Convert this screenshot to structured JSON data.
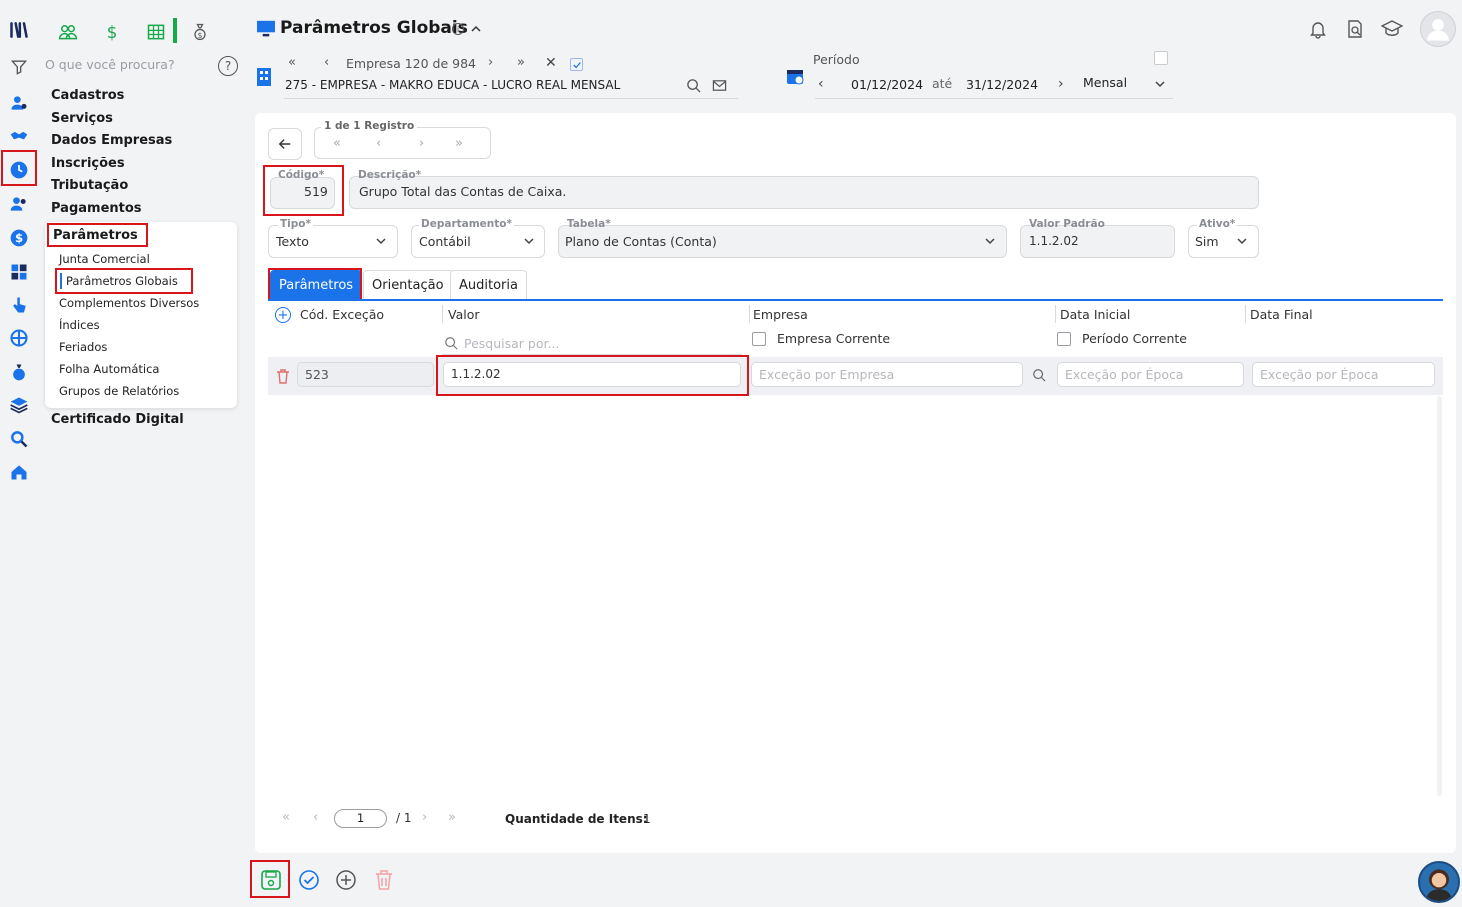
{
  "header": {
    "title": "Parâmetros Globais",
    "empresa_nav": "Empresa 120 de 984",
    "empresa_name": "275 - EMPRESA - MAKRO EDUCA - LUCRO REAL MENSAL",
    "periodo_label": "Período",
    "date_from": "01/12/2024",
    "ate": "até",
    "date_to": "31/12/2024",
    "period_mode": "Mensal"
  },
  "search": {
    "placeholder": "O que você procura?"
  },
  "menu": {
    "items": [
      "Cadastros",
      "Serviços",
      "Dados Empresas",
      "Inscrições",
      "Tributação",
      "Pagamentos",
      "Parâmetros"
    ],
    "sub_items": [
      "Junta Comercial",
      "Parâmetros Globais",
      "Complementos Diversos",
      "Índices",
      "Feriados",
      "Folha Automática",
      "Grupos de Relatórios"
    ],
    "footer_item": "Certificado Digital"
  },
  "record_nav": {
    "label": "1 de 1 Registro"
  },
  "form": {
    "codigo_label": "Código*",
    "codigo_value": "519",
    "descricao_label": "Descrição*",
    "descricao_value": "Grupo Total das Contas de Caixa.",
    "tipo_label": "Tipo*",
    "tipo_value": "Texto",
    "departamento_label": "Departamento*",
    "departamento_value": "Contábil",
    "tabela_label": "Tabela*",
    "tabela_value": "Plano de Contas (Conta)",
    "valor_padrao_label": "Valor Padrão",
    "valor_padrao_value": "1.1.2.02",
    "ativo_label": "Ativo*",
    "ativo_value": "Sim"
  },
  "tabs": [
    "Parâmetros",
    "Orientação",
    "Auditoria"
  ],
  "grid": {
    "columns": {
      "cod": "Cód. Exceção",
      "valor": "Valor",
      "empresa": "Empresa",
      "data_inicial": "Data Inicial",
      "data_final": "Data Final"
    },
    "search_placeholder": "Pesquisar por...",
    "empresa_corrente": "Empresa Corrente",
    "periodo_corrente": "Período Corrente",
    "row": {
      "cod": "523",
      "valor": "1.1.2.02",
      "empresa_ph": "Exceção por Empresa",
      "data_inicial_ph": "Exceção por Época",
      "data_final_ph": "Exceção por Época"
    }
  },
  "pagination": {
    "page": "1",
    "total": "/ 1",
    "qty_label": "Quantidade de Itens:",
    "qty_value": "1"
  },
  "colors": {
    "accent": "#1a73e8",
    "highlight": "#d8151b",
    "green": "#17a84b"
  }
}
